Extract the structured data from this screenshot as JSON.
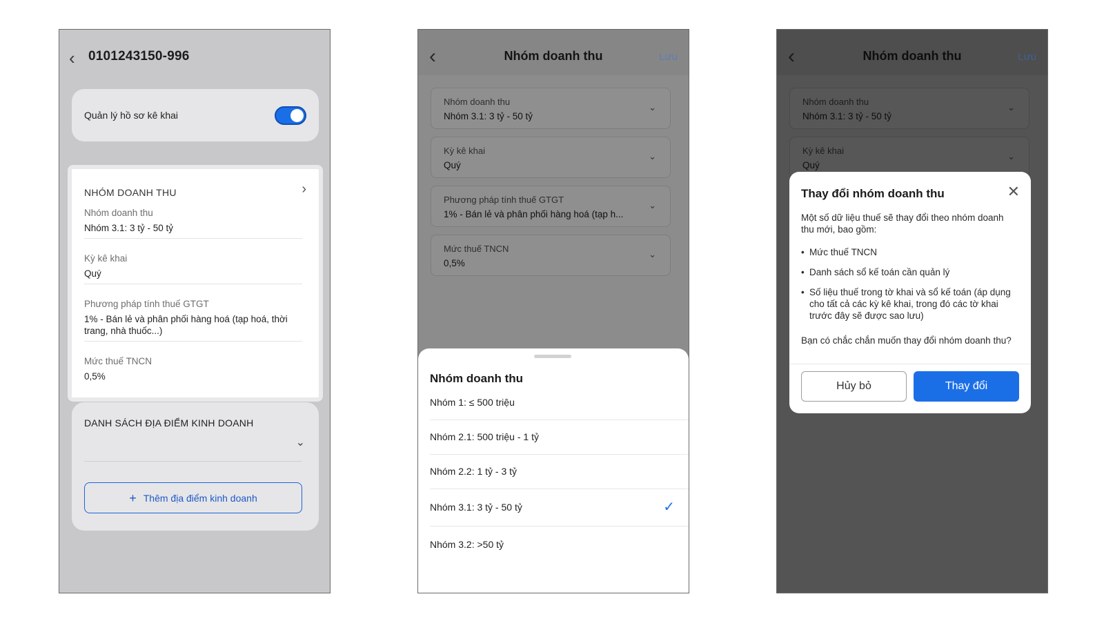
{
  "screen1": {
    "title": "0101243150-996",
    "toggle_label": "Quản lý hồ sơ kê khai",
    "revenue_section": {
      "heading": "NHÓM DOANH THU",
      "fields": [
        {
          "label": "Nhóm doanh thu",
          "value": "Nhóm 3.1: 3 tỷ - 50 tỷ"
        },
        {
          "label": "Kỳ kê khai",
          "value": "Quý"
        },
        {
          "label": "Phương pháp tính thuế GTGT",
          "value": "1% - Bán lẻ và phân phối hàng hoá (tạp hoá, thời trang, nhà thuốc...)"
        },
        {
          "label": "Mức thuế TNCN",
          "value": "0,5%"
        }
      ]
    },
    "locations": {
      "heading": "DANH SÁCH ĐỊA ĐIỂM KINH DOANH",
      "add_button": "Thêm địa điểm kinh doanh"
    }
  },
  "screen2": {
    "title": "Nhóm doanh thu",
    "save": "Lưu",
    "dropdowns": [
      {
        "label": "Nhóm doanh thu",
        "value": "Nhóm 3.1: 3 tỷ - 50 tỷ"
      },
      {
        "label": "Kỳ kê khai",
        "value": "Quý"
      },
      {
        "label": "Phương pháp tính thuế GTGT",
        "value": "1% - Bán lẻ và phân phối hàng hoá (tạp h..."
      },
      {
        "label": "Mức thuế TNCN",
        "value": "0,5%"
      }
    ],
    "sheet": {
      "title": "Nhóm doanh thu",
      "options": [
        "Nhóm 1: ≤ 500 triệu",
        "Nhóm 2.1: 500 triệu - 1 tỷ",
        "Nhóm 2.2: 1 tỷ - 3 tỷ",
        "Nhóm 3.1: 3 tỷ - 50 tỷ",
        "Nhóm 3.2: >50 tỷ"
      ],
      "selected": "Nhóm 3.1: 3 tỷ - 50 tỷ"
    }
  },
  "screen3": {
    "title": "Nhóm doanh thu",
    "save": "Lưu",
    "dropdowns": [
      {
        "label": "Nhóm doanh thu",
        "value": "Nhóm 3.1: 3 tỷ - 50 tỷ"
      },
      {
        "label": "Kỳ kê khai",
        "value": "Quý"
      }
    ],
    "dialog": {
      "title": "Thay đổi nhóm doanh thu",
      "intro": "Một số dữ liệu thuế sẽ thay đổi theo nhóm doanh thu mới, bao gồm:",
      "bullets": [
        "Mức thuế TNCN",
        "Danh sách sổ kế toán cần quản lý",
        "Số liệu thuế trong tờ khai và sổ kế toán (áp dụng cho tất cả các kỳ kê khai, trong đó các tờ khai trước đây sẽ được sao lưu)"
      ],
      "question": "Bạn có chắc chắn muốn thay đổi nhóm doanh thu?",
      "cancel": "Hủy bỏ",
      "confirm": "Thay đổi"
    }
  },
  "colors": {
    "accent": "#1b6fe6",
    "overlay_dim": "#545454"
  }
}
